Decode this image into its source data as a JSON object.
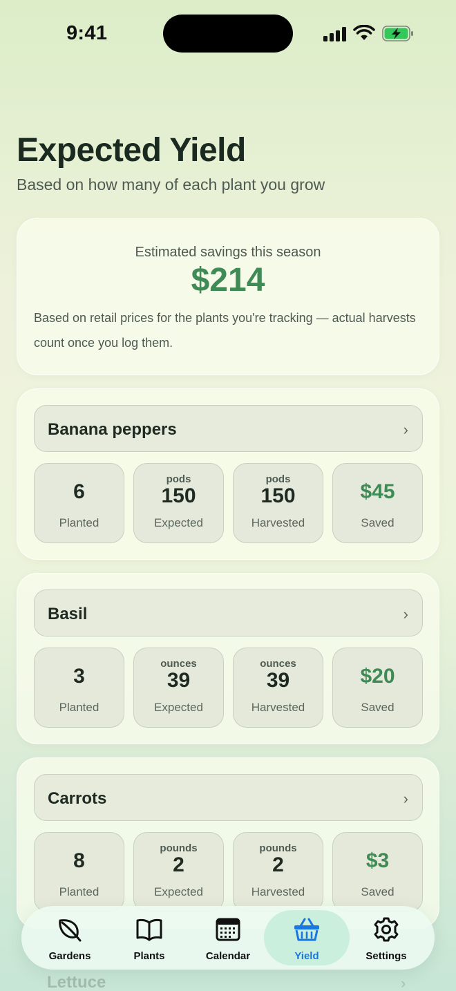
{
  "status": {
    "time": "9:41"
  },
  "header": {
    "title": "Expected Yield",
    "subtitle": "Based on how many of each plant you grow"
  },
  "summary": {
    "label": "Estimated savings this season",
    "value": "$214",
    "note": "Based on retail prices for the plants you're tracking — actual harvests count once you log them."
  },
  "plants": [
    {
      "name": "Banana peppers",
      "planted": "6",
      "expected_unit": "pods",
      "expected": "150",
      "harvested_unit": "pods",
      "harvested": "150",
      "saved": "$45"
    },
    {
      "name": "Basil",
      "planted": "3",
      "expected_unit": "ounces",
      "expected": "39",
      "harvested_unit": "ounces",
      "harvested": "39",
      "saved": "$20"
    },
    {
      "name": "Carrots",
      "planted": "8",
      "expected_unit": "pounds",
      "expected": "2",
      "harvested_unit": "pounds",
      "harvested": "2",
      "saved": "$3"
    },
    {
      "name": "Lettuce"
    }
  ],
  "stat_labels": {
    "planted": "Planted",
    "expected": "Expected",
    "harvested": "Harvested",
    "saved": "Saved"
  },
  "chevron": "›",
  "tabs": [
    {
      "label": "Gardens",
      "icon": "leaf-icon"
    },
    {
      "label": "Plants",
      "icon": "book-icon"
    },
    {
      "label": "Calendar",
      "icon": "calendar-icon"
    },
    {
      "label": "Yield",
      "icon": "basket-icon",
      "active": true
    },
    {
      "label": "Settings",
      "icon": "gear-icon"
    }
  ],
  "colors": {
    "accent_green": "#3f8a55",
    "active_tab": "#1877e0"
  }
}
